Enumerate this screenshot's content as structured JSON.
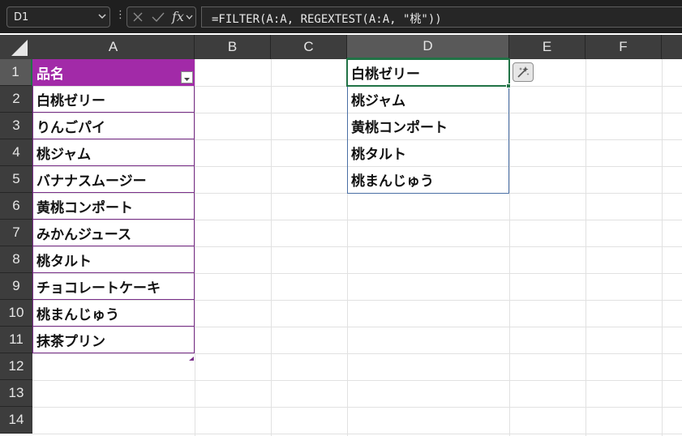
{
  "formula_bar": {
    "name_box": "D1",
    "fx_label": "fx",
    "formula": "=FILTER(A:A, REGEXTEST(A:A, \"桃\"))"
  },
  "columns": [
    "A",
    "B",
    "C",
    "D",
    "E",
    "F"
  ],
  "rows": [
    "1",
    "2",
    "3",
    "4",
    "5",
    "6",
    "7",
    "8",
    "9",
    "10",
    "11",
    "12",
    "13",
    "14"
  ],
  "table": {
    "header": "品名",
    "items": [
      "白桃ゼリー",
      "りんごパイ",
      "桃ジャム",
      "バナナスムージー",
      "黄桃コンポート",
      "みかんジュース",
      "桃タルト",
      "チョコレートケーキ",
      "桃まんじゅう",
      "抹茶プリン"
    ]
  },
  "result": {
    "items": [
      "白桃ゼリー",
      "桃ジャム",
      "黄桃コンポート",
      "桃タルト",
      "桃まんじゅう"
    ]
  },
  "colors": {
    "table_header_bg": "#a22aa8",
    "active_border": "#217346"
  },
  "selection": {
    "active_cell": "D1"
  }
}
